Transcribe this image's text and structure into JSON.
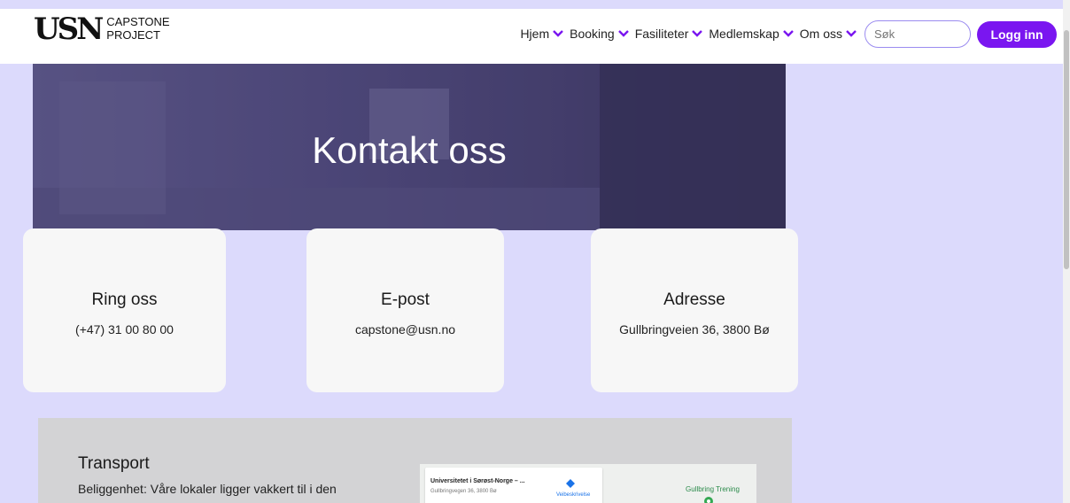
{
  "header": {
    "logo_mark": "USN",
    "logo_line1": "CAPSTONE",
    "logo_line2": "PROJECT",
    "nav": [
      {
        "label": "Hjem"
      },
      {
        "label": "Booking"
      },
      {
        "label": "Fasiliteter"
      },
      {
        "label": "Medlemskap"
      },
      {
        "label": "Om oss"
      }
    ],
    "search_placeholder": "Søk",
    "login_label": "Logg inn"
  },
  "colors": {
    "accent": "#7a16f0",
    "page_bg": "#dcdafc",
    "card_bg": "#f7f7f7"
  },
  "hero": {
    "title": "Kontakt oss"
  },
  "contacts": [
    {
      "title": "Ring oss",
      "value": "(+47) 31 00 80 00"
    },
    {
      "title": "E-post",
      "value": "capstone@usn.no"
    },
    {
      "title": "Adresse",
      "value": "Gullbringveien 36, 3800 Bø"
    }
  ],
  "transport": {
    "title": "Transport",
    "text": "Beliggenhet: Våre lokaler ligger vakkert til i den",
    "map": {
      "place": "Universitetet i Sørøst-Norge – ...",
      "address": "Gullbringvegen 36, 3800 Bø",
      "directions": "Veibeskrivelse",
      "poi": "Gullbring Trening"
    }
  }
}
